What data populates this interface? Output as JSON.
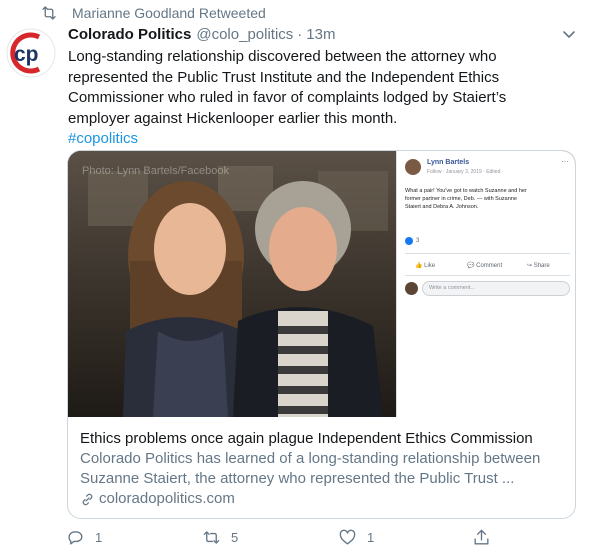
{
  "retweet": {
    "label": "Marianne Goodland Retweeted"
  },
  "tweet": {
    "display_name": "Colorado Politics",
    "handle": "@colo_politics",
    "separator": "·",
    "time": "13m",
    "text_lines": [
      "Long-standing relationship discovered between the attorney who",
      "represented the Public Trust Institute and the Independent Ethics",
      "Commissioner who ruled in favor of complaints lodged by Staiert’s",
      "employer against Hickenlooper earlier this month."
    ],
    "hashtag": "#copolitics"
  },
  "avatar": {
    "letters": "cp"
  },
  "card": {
    "photo_watermark": "Photo: Lynn Bartels/Facebook",
    "facebook_post": {
      "author": "Lynn Bartels",
      "meta": "Follow · January 3, 2019 · Edited ·",
      "text_line1": "What a pair! You've got to watch Suzanne and her",
      "text_line2": "former partner in crime, Deb. — with Suzanne",
      "text_line3": "Staiert and Debra A. Johnson.",
      "reactions": "3",
      "like": "Like",
      "comment": "Comment",
      "share": "Share",
      "comment_placeholder": "Write a comment..."
    },
    "title": "Ethics problems once again plague Independent Ethics Commission",
    "description_line1": "Colorado Politics has learned of a long-standing relationship between",
    "description_line2": "Suzanne Staiert, the attorney who represented the Public Trust ...",
    "domain": "coloradopolitics.com"
  },
  "actions": {
    "reply_count": "1",
    "retweet_count": "5",
    "like_count": "1"
  },
  "colors": {
    "link_blue": "#1b95e0",
    "secondary_gray": "#657786",
    "brand_red": "#d7262c",
    "brand_navy": "#1d3467"
  }
}
